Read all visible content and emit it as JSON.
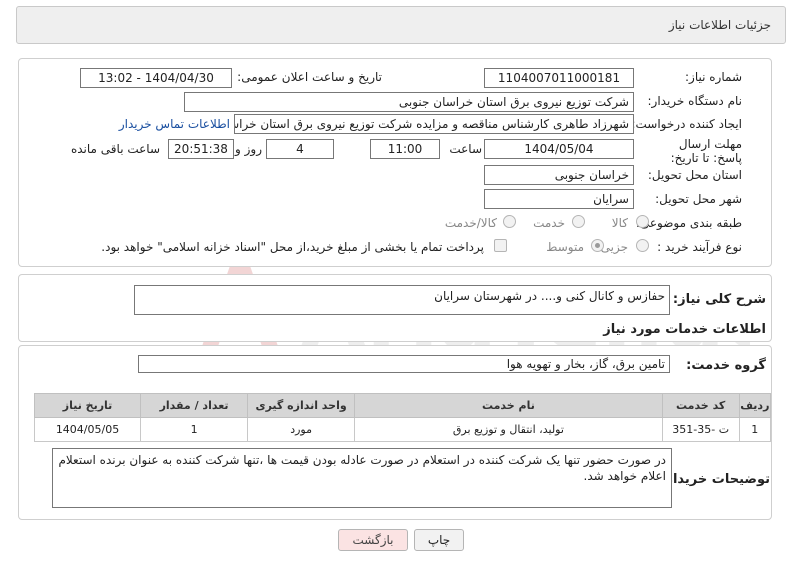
{
  "header": {
    "title": "جزئیات اطلاعات نیاز"
  },
  "form": {
    "need_number_label": "شماره نیاز:",
    "need_number": "1104007011000181",
    "announce_label": "تاریخ و ساعت اعلان عمومی:",
    "announce_value": "1404/04/30 - 13:02",
    "buyer_org_label": "نام دستگاه خریدار:",
    "buyer_org": "شرکت توزیع نیروی برق استان خراسان جنوبی",
    "requester_label": "ایجاد کننده درخواست:",
    "requester": "شهرزاد طاهری کارشناس مناقصه و مزایده شرکت توزیع نیروی برق استان خراسان جنوبی",
    "buyer_contact_link": "اطلاعات تماس خریدار",
    "deadline_label": "مهلت ارسال پاسخ: تا تاریخ:",
    "deadline_date": "1404/05/04",
    "time_label": "ساعت",
    "deadline_time": "11:00",
    "days_value": "4",
    "days_label": "روز و",
    "remaining_time": "20:51:38",
    "remaining_label": "ساعت باقی مانده",
    "province_label": "استان محل تحویل:",
    "province": "خراسان جنوبی",
    "city_label": "شهر محل تحویل:",
    "city": "سرایان",
    "category_label": "طبقه بندی موضوعی:",
    "category_options": [
      "کالا",
      "خدمت",
      "کالا/خدمت"
    ],
    "category_selected": "خدمت",
    "process_label": "نوع فرآیند خرید :",
    "process_options": [
      "جزیی",
      "متوسط"
    ],
    "process_selected": "متوسط",
    "payment_note": "پرداخت تمام یا بخشی از مبلغ خرید،از محل \"اسناد خزانه اسلامی\" خواهد بود."
  },
  "description": {
    "label": "شرح کلی نیاز:",
    "text": "حفازس و کانال کنی و.... در شهرستان سرایان"
  },
  "services": {
    "section_title": "اطلاعات خدمات مورد نیاز",
    "group_label": "گروه خدمت:",
    "group_value": "تامین برق، گاز، بخار و تهویه هوا",
    "columns": [
      "ردیف",
      "کد خدمت",
      "نام خدمت",
      "واحد اندازه گیری",
      "تعداد / مقدار",
      "تاریخ نیاز"
    ],
    "rows": [
      [
        "1",
        "ت -35-351",
        "تولید، انتقال و توزیع برق",
        "مورد",
        "1",
        "1404/05/05"
      ]
    ]
  },
  "buyer_notes": {
    "label": "توضیحات خریدار:",
    "text": "در صورت حضور تنها یک شرکت کننده در استعلام در صورت عادله بودن قیمت ها ،تنها شرکت کننده به عنوان برنده استعلام اعلام خواهد شد."
  },
  "buttons": {
    "print": "چاپ",
    "back": "بازگشت"
  },
  "watermark_text": "AriaTender.neT",
  "colors": {
    "link": "#1a4fa0",
    "back_button_bg": "#fbe3e3",
    "header_bg": "#efefef"
  }
}
